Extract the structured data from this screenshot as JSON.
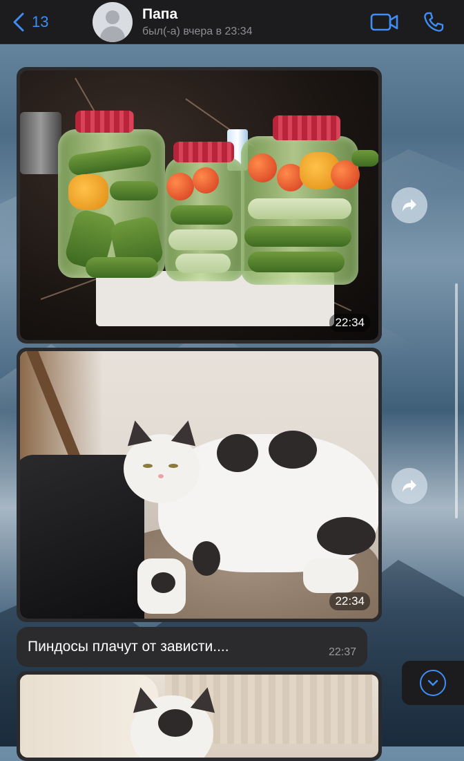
{
  "header": {
    "back_count": "13",
    "title": "Папа",
    "subtitle": "был(-а) вчера в 23:34"
  },
  "messages": [
    {
      "type": "photo",
      "content": "pickled vegetable jars",
      "time": "22:34"
    },
    {
      "type": "photo",
      "content": "white and black cat lying on blanket",
      "time": "22:34"
    },
    {
      "type": "text",
      "text": "Пиндосы плачут от зависти....",
      "time": "22:37"
    },
    {
      "type": "photo",
      "content": "cat partially visible",
      "time": ""
    }
  ],
  "icons": {
    "back": "chevron-left-icon",
    "video": "video-camera-icon",
    "call": "phone-icon",
    "share": "share-arrow-icon",
    "scroll_down": "chevron-down-icon"
  },
  "colors": {
    "accent": "#3e8ef7",
    "header_bg": "#1c1c1e",
    "bubble_bg": "#2b2b2d"
  }
}
